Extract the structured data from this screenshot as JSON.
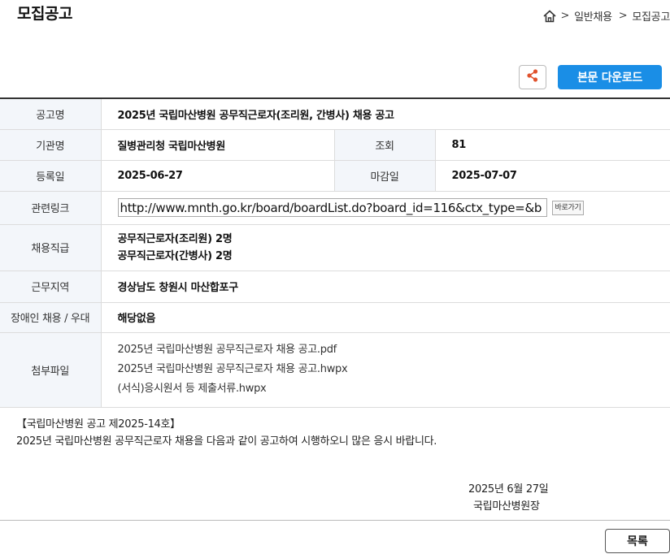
{
  "page": {
    "title": "모집공고"
  },
  "breadcrumb": {
    "sep": ">",
    "items": [
      "일반채용",
      "모집공고"
    ]
  },
  "toolbar": {
    "download_label": "본문 다운로드"
  },
  "info": {
    "title_label": "공고명",
    "title_value": "2025년 국립마산병원 공무직근로자(조리원, 간병사) 채용 공고",
    "org_label": "기관명",
    "org_value": "질병관리청 국립마산병원",
    "views_label": "조회",
    "views_value": "81",
    "reg_label": "등록일",
    "reg_value": "2025-06-27",
    "deadline_label": "마감일",
    "deadline_value": "2025-07-07",
    "link_label": "관련링크",
    "link_value": "http://www.mnth.go.kr/board/boardList.do?board_id=116&ctx_type=&b",
    "link_go": "바로가기",
    "positions_label": "채용직급",
    "positions": [
      "공무직근로자(조리원) 2명",
      "공무직근로자(간병사) 2명"
    ],
    "location_label": "근무지역",
    "location_value": "경상남도 창원시 마산합포구",
    "disabled_label": "장애인 채용 / 우대",
    "disabled_value": "해당없음",
    "files_label": "첨부파일",
    "files": [
      "2025년 국립마산병원 공무직근로자 채용 공고.pdf",
      "2025년 국립마산병원 공무직근로자 채용 공고.hwpx",
      "(서식)응시원서 등 제출서류.hwpx"
    ]
  },
  "notice": {
    "heading": "【국립마산병원 공고 제2025-14호】",
    "body": "2025년 국립마산병원 공무직근로자 채용을 다음과 같이 공고하여 시행하오니 많은 응시 바랍니다."
  },
  "signature": {
    "date": "2025년 6월 27일",
    "org": "국립마산병원장"
  },
  "footer": {
    "list_label": "목록"
  },
  "colors": {
    "accent": "#1a8ee6",
    "header_bg": "#f3f6fa"
  }
}
